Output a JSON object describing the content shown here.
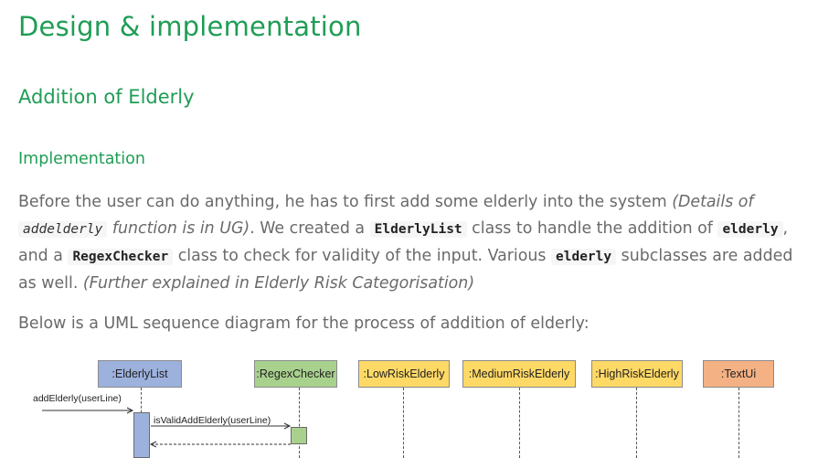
{
  "headings": {
    "h1": "Design & implementation",
    "h2": "Addition of Elderly",
    "h3": "Implementation"
  },
  "paragraph1": {
    "t1": "Before the user can do anything, he has to first add some elderly into the system ",
    "t2_italic": "(Details of ",
    "code1": "addelderly",
    "t3_italic": " function is in UG)",
    "t4": ". We created a ",
    "code2": "ElderlyList",
    "t5": " class to handle the addition of ",
    "code3": "elderly",
    "t6": ", and a ",
    "code4": "RegexChecker",
    "t7": " class to check for validity of the input. Various ",
    "code5": "elderly",
    "t8": " subclasses are added as well. ",
    "t9_italic": "(Further explained in Elderly Risk Categorisation)"
  },
  "paragraph2": "Below is a UML sequence diagram for the process of addition of elderly:",
  "diagram": {
    "actors": [
      {
        "label": ":ElderlyList",
        "color": "#9db1dd"
      },
      {
        "label": ":RegexChecker",
        "color": "#a9d18e"
      },
      {
        "label": ":LowRiskElderly",
        "color": "#ffd966"
      },
      {
        "label": ":MediumRiskElderly",
        "color": "#ffd966"
      },
      {
        "label": ":HighRiskElderly",
        "color": "#ffd966"
      },
      {
        "label": ":TextUi",
        "color": "#f4b183"
      }
    ],
    "messages": {
      "m1": "addElderly(userLine)",
      "m2": "isValidAddElderly(userLine)"
    }
  }
}
